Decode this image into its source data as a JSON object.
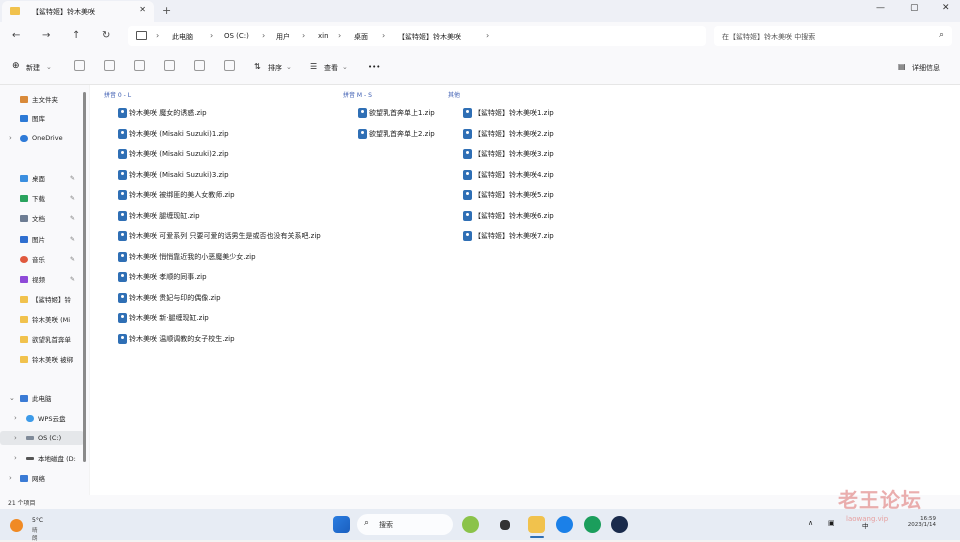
{
  "window": {
    "tab_title": "【鲨特姬】铃木美咲",
    "new_tab_symbol": "+",
    "close_tab_symbol": "✕",
    "controls": [
      "—",
      "▢",
      "✕"
    ]
  },
  "address": {
    "crumbs": [
      "此电脑",
      "OS (C:)",
      "用户",
      "xin",
      "桌面",
      "【鲨特姬】铃木美咲"
    ],
    "search_placeholder": "在【鲨特姬】铃木美咲 中搜索"
  },
  "toolbar": {
    "new_label": "新建",
    "sort_label": "排序",
    "view_label": "查看",
    "more_label": "•••",
    "details_label": "详细信息"
  },
  "groups": [
    {
      "header": "拼音 0 - L",
      "files": [
        "铃木美咲 魔女的诱惑.zip",
        "铃木美咲 (Misaki Suzuki)1.zip",
        "铃木美咲 (Misaki Suzuki)2.zip",
        "铃木美咲 (Misaki Suzuki)3.zip",
        "铃木美咲 被绑匪的美人女教师.zip",
        "铃木美咲 腿缠现缸.zip",
        "铃木美咲 可爱系列 只要可爱的话男生是或否也没有关系吧.zip",
        "铃木美咲 悄悄靠近我的小恶魔美少女.zip",
        "铃木美咲 孝顺的同事.zip",
        "铃木美咲 贵妃与印的偶像.zip",
        "铃木美咲 新·腿缠现缸.zip",
        "铃木美咲 温顺调教的女子校生.zip"
      ]
    },
    {
      "header": "拼音 M - S",
      "files": [
        "欲望乳首奔单上1.zip",
        "欲望乳首奔单上2.zip"
      ]
    },
    {
      "header": "其他",
      "files": [
        "【鲨特姬】铃木美咲1.zip",
        "【鲨特姬】铃木美咲2.zip",
        "【鲨特姬】铃木美咲3.zip",
        "【鲨特姬】铃木美咲4.zip",
        "【鲨特姬】铃木美咲5.zip",
        "【鲨特姬】铃木美咲6.zip",
        "【鲨特姬】铃木美咲7.zip"
      ]
    }
  ],
  "sidebar": {
    "quick": [
      "主文件夹",
      "图库",
      "OneDrive"
    ],
    "pinned": [
      "桌面",
      "下载",
      "文档",
      "图片",
      "音乐",
      "视频",
      "【鲨特姬】铃",
      "铃木美咲 (Mi",
      "欲望乳首奔单",
      "铃木美咲 被绑"
    ],
    "drives": [
      "此电脑",
      "WPS云盘",
      "OS (C:)",
      "本地磁盘 (D:",
      "网络"
    ]
  },
  "status": {
    "item_count": "21 个项目"
  },
  "taskbar": {
    "weather_temp": "5°C",
    "weather_desc": "晴朗",
    "search_label": "搜索",
    "time": "16:59",
    "date": "2023/1/14",
    "ime": "中"
  },
  "watermark": {
    "text": "老王论坛",
    "sub": "laowang.vip"
  },
  "colors": {
    "accent": "#2f6fb5",
    "group_header": "#3a5bb1",
    "taskbar": "#e7ecf4"
  }
}
